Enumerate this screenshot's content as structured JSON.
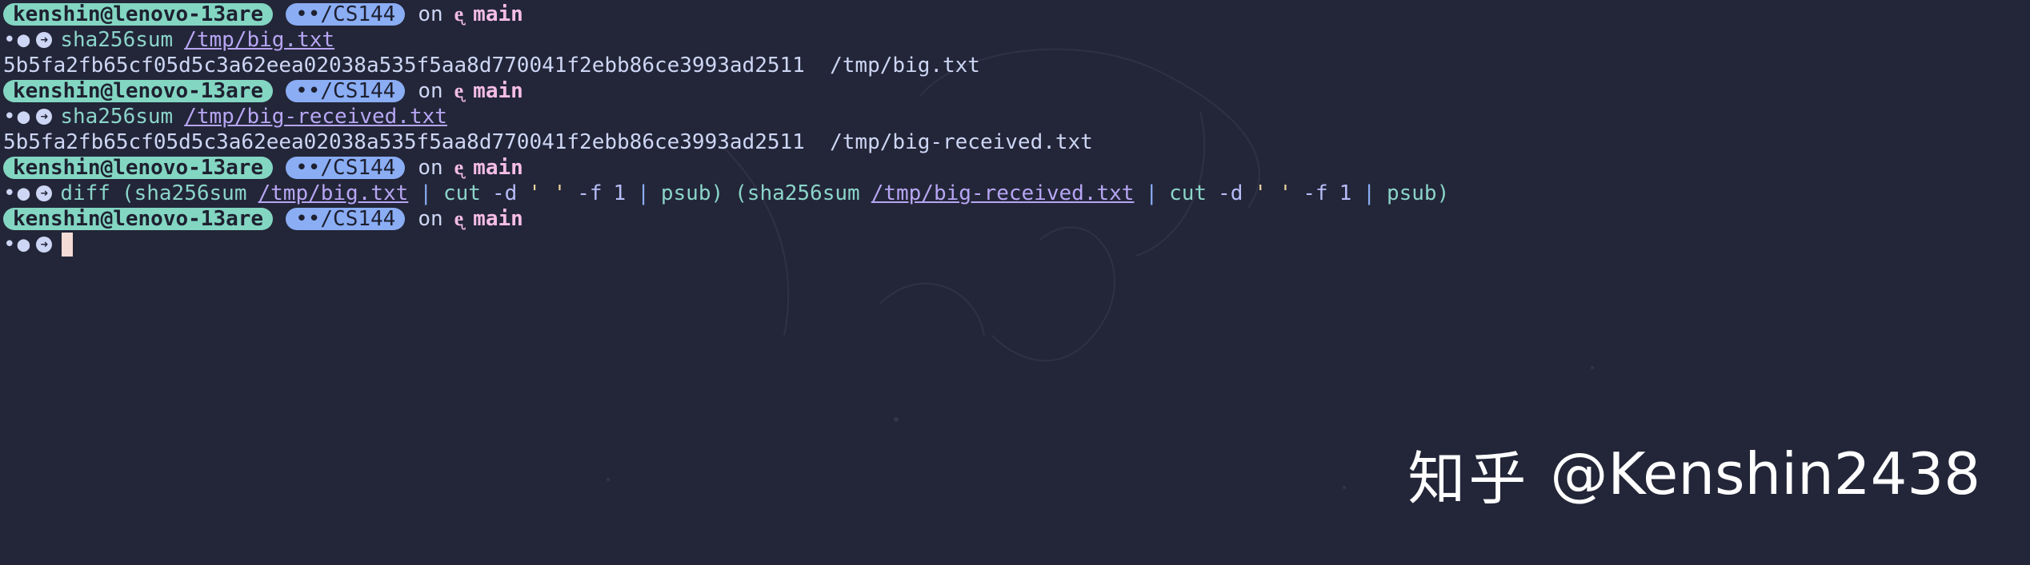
{
  "prompt": {
    "user_host": "kenshin@lenovo-13are",
    "dir": "••/CS144",
    "on": "on",
    "branch_icon": "ᶒ",
    "branch": "main",
    "dots": "•●",
    "arrow": "➜"
  },
  "lines": {
    "cmd1": {
      "cmd": "sha256sum",
      "path": "/tmp/big.txt"
    },
    "out1": "5b5fa2fb65cf05d5c3a62eea02038a535f5aa8d770041f2ebb86ce3993ad2511  /tmp/big.txt",
    "cmd2": {
      "cmd": "sha256sum",
      "path": "/tmp/big-received.txt"
    },
    "out2": "5b5fa2fb65cf05d5c3a62eea02038a535f5aa8d770041f2ebb86ce3993ad2511  /tmp/big-received.txt",
    "cmd3": {
      "diff": "diff",
      "open1": "(sha256sum",
      "path1": "/tmp/big.txt",
      "pipe": "|",
      "cut": "cut",
      "d": "-d",
      "q": "' '",
      "f": "-f",
      "one": "1",
      "psub": "psub",
      "close": ")",
      "open2": "(sha256sum",
      "path2": "/tmp/big-received.txt"
    }
  },
  "watermark": {
    "site": "知乎",
    "handle": "@Kenshin2438"
  },
  "colors": {
    "background": "#232638",
    "user_pill": "#83d6c2",
    "dir_pill": "#8aadf4",
    "branch": "#f5bde6",
    "command": "#8bd5ca",
    "path": "#b7a6f4",
    "cursor": "#f4dbd6"
  }
}
